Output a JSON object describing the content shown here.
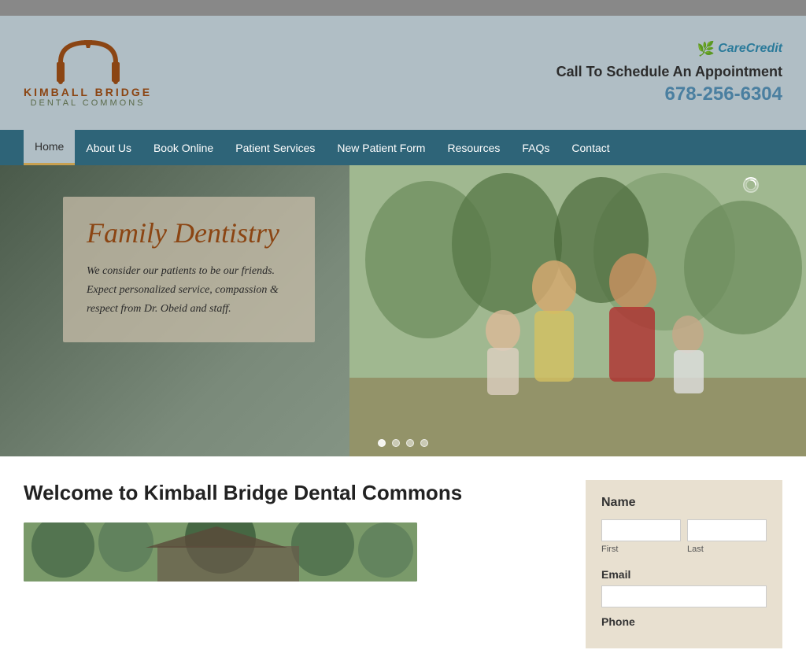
{
  "top_bar": {},
  "header": {
    "logo": {
      "line1": "KIMBALL BRIDGE",
      "line2": "DENTAL COMMONS"
    },
    "care_credit_label": "CareCredit",
    "schedule_label": "Call To Schedule An Appointment",
    "phone": "678-256-6304"
  },
  "nav": {
    "items": [
      {
        "label": "Home",
        "active": true
      },
      {
        "label": "About Us",
        "active": false
      },
      {
        "label": "Book Online",
        "active": false
      },
      {
        "label": "Patient Services",
        "active": false
      },
      {
        "label": "New Patient Form",
        "active": false
      },
      {
        "label": "Resources",
        "active": false
      },
      {
        "label": "FAQs",
        "active": false
      },
      {
        "label": "Contact",
        "active": false
      }
    ]
  },
  "hero": {
    "title": "Family Dentistry",
    "description": "We consider our patients to be our friends. Expect personalized service, compassion & respect from Dr. Obeid and staff.",
    "dots": 4
  },
  "main": {
    "welcome_title": "Welcome to Kimball Bridge Dental Commons"
  },
  "sidebar_form": {
    "name_label": "Name",
    "first_label": "First",
    "last_label": "Last",
    "email_label": "Email",
    "phone_label": "Phone"
  }
}
